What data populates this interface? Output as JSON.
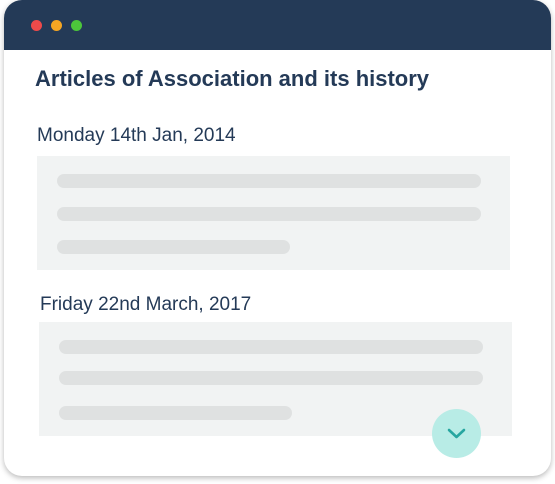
{
  "window": {
    "controls": {
      "close": {
        "icon": "close-dot-icon",
        "color": "#ef4a4a"
      },
      "minimize": {
        "icon": "minimize-dot-icon",
        "color": "#f5a623"
      },
      "maximize": {
        "icon": "maximize-dot-icon",
        "color": "#4cc63b"
      }
    },
    "titlebar_color": "#243a57"
  },
  "main": {
    "title": "Articles of Association and its history",
    "entries": [
      {
        "date": "Monday 14th Jan, 2014"
      },
      {
        "date": "Friday 22nd March, 2017"
      }
    ]
  },
  "scroll_button": {
    "icon": "chevron-down-icon",
    "color": "#b8ece6",
    "icon_color": "#26a6a0"
  }
}
